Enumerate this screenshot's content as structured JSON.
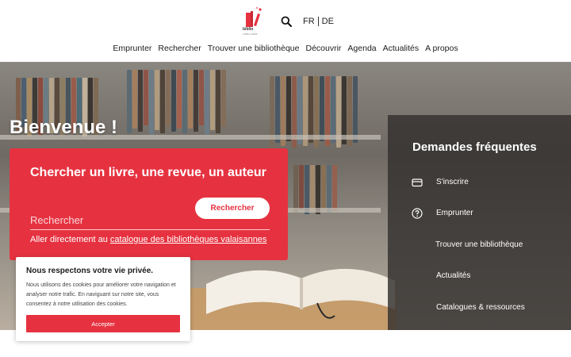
{
  "header": {
    "logo_text": "biblio",
    "logo_sub": "valais wallis",
    "lang": {
      "fr": "FR",
      "de": "DE"
    },
    "nav": [
      "Emprunter",
      "Rechercher",
      "Trouver une bibliothèque",
      "Découvrir",
      "Agenda",
      "Actualités",
      "A propos"
    ]
  },
  "hero": {
    "welcome": "Bienvenue !",
    "search": {
      "title": "Chercher un livre, une revue, un auteur",
      "placeholder": "Rechercher",
      "button": "Rechercher",
      "catalog_prefix": "Aller directement au ",
      "catalog_link": "catalogue des bibliothèques valaisannes"
    },
    "faq": {
      "title": "Demandes fréquentes",
      "items": [
        {
          "label": "S'inscrire",
          "icon": "card-icon"
        },
        {
          "label": "Emprunter",
          "icon": "question-icon"
        },
        {
          "label": "Trouver une bibliothèque",
          "icon": ""
        },
        {
          "label": "Actualités",
          "icon": ""
        },
        {
          "label": "Catalogues & ressources",
          "icon": ""
        }
      ]
    }
  },
  "cookie": {
    "title": "Nous respectons votre vie privée.",
    "text": "Nous utilisons des cookies pour améliorer votre navigation et analyser notre trafic. En naviguant sur notre site, vous consentez à notre utilisation des cookies.",
    "accept": "Accepter"
  },
  "colors": {
    "accent": "#e63240",
    "faq_bg": "#32302e"
  }
}
